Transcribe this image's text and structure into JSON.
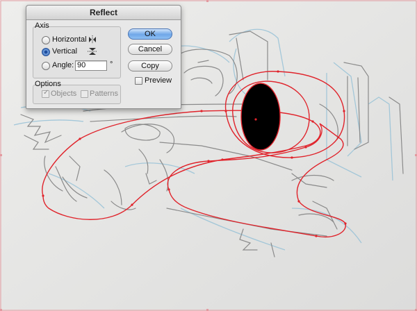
{
  "dialog": {
    "title": "Reflect",
    "axis": {
      "group_label": "Axis",
      "horizontal_label": "Horizontal",
      "vertical_label": "Vertical",
      "angle_label": "Angle:",
      "angle_value": "90",
      "angle_unit": "°",
      "selected": "vertical"
    },
    "options": {
      "group_label": "Options",
      "objects_label": "Objects",
      "patterns_label": "Patterns",
      "objects_checked": true,
      "patterns_checked": false
    },
    "buttons": {
      "ok": "OK",
      "cancel": "Cancel",
      "copy": "Copy"
    },
    "preview_label": "Preview",
    "preview_checked": false
  },
  "colors": {
    "selection_path": "#e0232b",
    "sketch_pencil": "#8a8a8a",
    "sketch_blue": "#9cc4d8"
  },
  "icons": [
    "reflect-horizontal-icon",
    "reflect-vertical-icon"
  ]
}
